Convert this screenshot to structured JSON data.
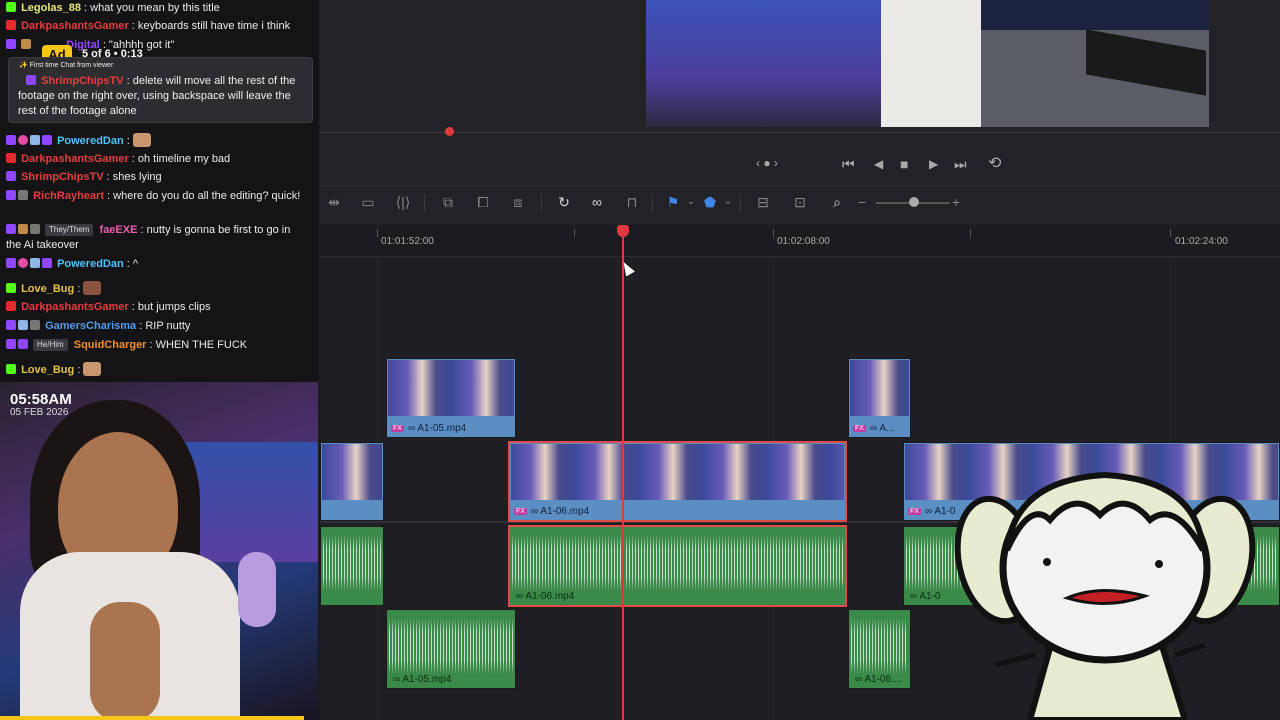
{
  "chat": {
    "messages": [
      {
        "user": "Legolas_88",
        "color": "#e7e77a",
        "text": ": what you mean by this title"
      },
      {
        "user": "DarkpashantsGamer",
        "color": "#e63d3d",
        "text": ": keyboards still have time i think"
      },
      {
        "user": "Digital",
        "color": "#9146ff",
        "text": ": \"ahhhh got it\""
      },
      {
        "user": "PoweredDan",
        "color": "#4fc3f7",
        "text": ":"
      },
      {
        "user": "DarkpashantsGamer",
        "color": "#e63d3d",
        "text": ": oh timeline my bad"
      },
      {
        "user": "ShrimpChipsTV",
        "color": "#e63d3d",
        "text": ": shes lying"
      },
      {
        "user": "RichRayheart",
        "color": "#e63d3d",
        "text": ": where do you do all the editing? quick!"
      },
      {
        "user": "faeEXE",
        "color": "#e95fb0",
        "pronoun": "They/Them",
        "text": ": nutty is gonna be first to go in the Ai takeover"
      },
      {
        "user": "PoweredDan",
        "color": "#4fc3f7",
        "text": ": ^"
      },
      {
        "user": "Love_Bug",
        "color": "#e7c14a",
        "text": ":"
      },
      {
        "user": "DarkpashantsGamer",
        "color": "#e63d3d",
        "text": ": but jumps clips"
      },
      {
        "user": "GamersCharisma",
        "color": "#4f9cf0",
        "text": ": RIP nutty"
      },
      {
        "user": "SquidCharger",
        "color": "#f08f2a",
        "pronoun": "He/Him",
        "text": ": WHEN THE FUCK"
      },
      {
        "user": "Love_Bug",
        "color": "#e7c14a",
        "text": ":"
      }
    ],
    "ad": {
      "label": "Ad",
      "counter": "5 of 6 • 0:13"
    },
    "first_chat": {
      "label": "✨ First time Chat from viewer",
      "user": "ShrimpChipsTV",
      "text": ": delete will move all the rest of the footage on the right over, using backspace will leave the rest of the footage alone"
    }
  },
  "webcam": {
    "time": "05:58AM",
    "date": "05 FEB 2026"
  },
  "transport": {
    "nav": "‹ ● ›",
    "first": "⏮",
    "back": "◀",
    "stop": "■",
    "play": "▶",
    "last": "⏭",
    "loop": "⟲"
  },
  "toolbar": {
    "icons": [
      "trim-icon",
      "blade-icon",
      "slip-icon",
      "overwrite-icon",
      "insert-icon",
      "replace-icon",
      "snap-icon",
      "link-icon",
      "lock-icon",
      "flag-icon",
      "marker-icon",
      "zoom-full-icon",
      "zoom-detail-icon",
      "zoom-custom-icon",
      "zoom-out-icon",
      "zoom-in-icon"
    ],
    "zoom_minus": "−",
    "zoom_plus": "+"
  },
  "ruler": {
    "timecodes": [
      "01:01:52:00",
      "01:02:08:00",
      "01:02:24:00"
    ]
  },
  "clips": {
    "v2_a": "A1-05.mp4",
    "v2_b": "A...",
    "v1_main": "A1-06.mp4",
    "v1_right": "A1-0",
    "a1_main": "A1-06.mp4",
    "a1_right": "A1-0",
    "a2_a": "A1-05.mp4",
    "a2_b": "A1-06...."
  },
  "fx_badge": "FX",
  "colors": {
    "playhead": "#e0393e",
    "video_clip": "#5b8fc4",
    "audio_clip": "#3a8a4a",
    "selection": "#e24a4a"
  }
}
